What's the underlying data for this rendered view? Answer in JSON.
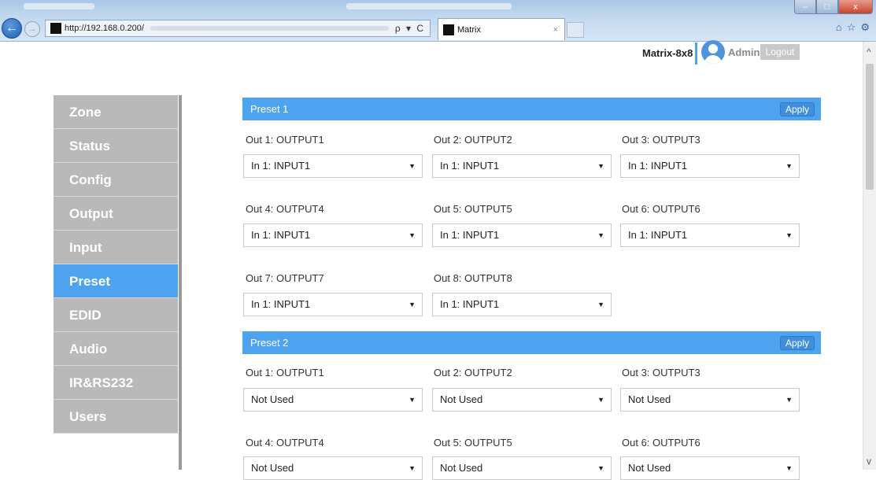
{
  "browser": {
    "url": "http://192.168.0.200/",
    "tab_title": "Matrix",
    "tab_close": "×",
    "addr_tools": "ρ ▾ C",
    "win_min": "–",
    "win_max": "□",
    "win_close": "x",
    "icons": {
      "home": "⌂",
      "star": "☆",
      "settings": "⚙"
    }
  },
  "header": {
    "device_name": "Matrix-8x8",
    "user": "Admin",
    "logout_label": "Logout"
  },
  "sidebar": {
    "items": [
      {
        "label": "Zone",
        "active": false
      },
      {
        "label": "Status",
        "active": false
      },
      {
        "label": "Config",
        "active": false
      },
      {
        "label": "Output",
        "active": false
      },
      {
        "label": "Input",
        "active": false
      },
      {
        "label": "Preset",
        "active": true
      },
      {
        "label": "EDID",
        "active": false
      },
      {
        "label": "Audio",
        "active": false
      },
      {
        "label": "IR&RS232",
        "active": false
      },
      {
        "label": "Users",
        "active": false
      }
    ]
  },
  "presets": [
    {
      "title": "Preset 1",
      "apply_label": "Apply",
      "outputs": [
        {
          "label": "Out 1: OUTPUT1",
          "value": "In 1: INPUT1"
        },
        {
          "label": "Out 2: OUTPUT2",
          "value": "In 1: INPUT1"
        },
        {
          "label": "Out 3: OUTPUT3",
          "value": "In 1: INPUT1"
        },
        {
          "label": "Out 4: OUTPUT4",
          "value": "In 1: INPUT1"
        },
        {
          "label": "Out 5: OUTPUT5",
          "value": "In 1: INPUT1"
        },
        {
          "label": "Out 6: OUTPUT6",
          "value": "In 1: INPUT1"
        },
        {
          "label": "Out 7: OUTPUT7",
          "value": "In 1: INPUT1"
        },
        {
          "label": "Out 8: OUTPUT8",
          "value": "In 1: INPUT1"
        }
      ]
    },
    {
      "title": "Preset 2",
      "apply_label": "Apply",
      "outputs": [
        {
          "label": "Out 1: OUTPUT1",
          "value": "Not Used"
        },
        {
          "label": "Out 2: OUTPUT2",
          "value": "Not Used"
        },
        {
          "label": "Out 3: OUTPUT3",
          "value": "Not Used"
        },
        {
          "label": "Out 4: OUTPUT4",
          "value": "Not Used"
        },
        {
          "label": "Out 5: OUTPUT5",
          "value": "Not Used"
        },
        {
          "label": "Out 6: OUTPUT6",
          "value": "Not Used"
        }
      ]
    }
  ],
  "colors": {
    "accent": "#4da3f0",
    "sidebar_bg": "#b9b9b9",
    "logout_bg": "#c8c8c8"
  },
  "icons": {
    "caret": "▼",
    "scroll_up": "^",
    "scroll_down": "v",
    "back": "back-arrow-icon",
    "forward": "forward-arrow-icon",
    "avatar": "user-avatar-icon"
  }
}
